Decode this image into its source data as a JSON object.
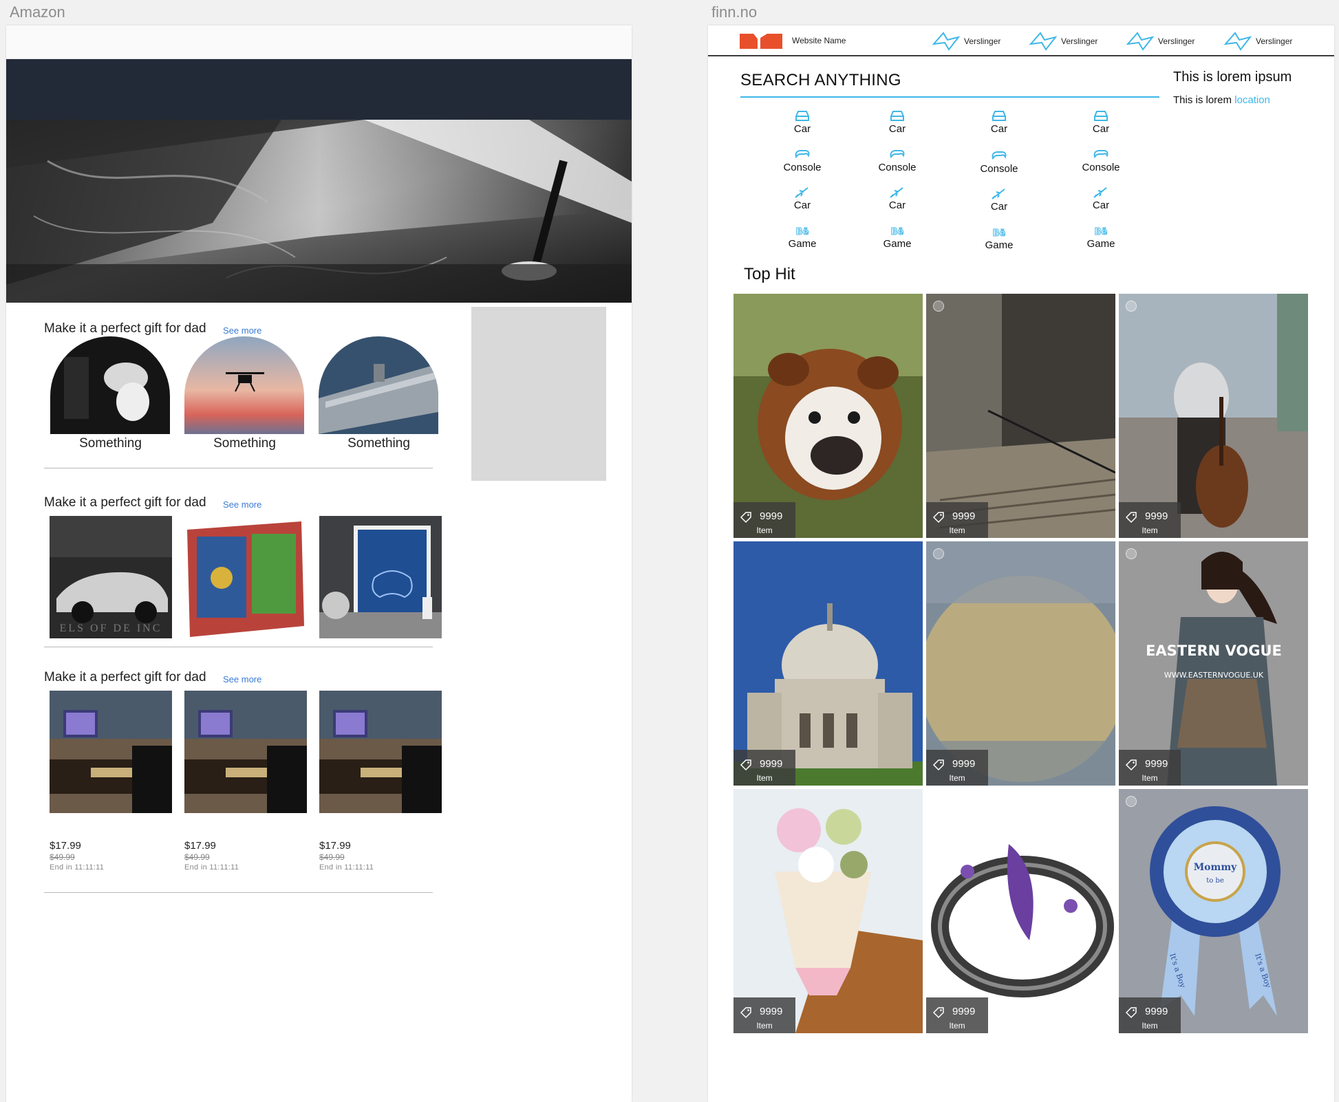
{
  "artboards": {
    "amazon_label": "Amazon",
    "finn_label": "finn.no"
  },
  "amazon": {
    "sections": [
      {
        "title": "Make it a perfect gift for dad",
        "see_more": "See more"
      },
      {
        "title": "Make it a perfect gift for dad",
        "see_more": "See more"
      },
      {
        "title": "Make it a perfect gift for dad",
        "see_more": "See more"
      }
    ],
    "circle_items": [
      {
        "label": "Something"
      },
      {
        "label": "Something"
      },
      {
        "label": "Something"
      }
    ],
    "product_image_text": "ELS OF DE INC",
    "deals": [
      {
        "price": "$17.99",
        "old_price": "$49.99",
        "ends": "End in 11:11:11"
      },
      {
        "price": "$17.99",
        "old_price": "$49.99",
        "ends": "End in 11:11:11"
      },
      {
        "price": "$17.99",
        "old_price": "$49.99",
        "ends": "End in 11:11:11"
      }
    ]
  },
  "finn": {
    "site_name": "Website Name",
    "nav": [
      {
        "label": "Verslinger"
      },
      {
        "label": "Verslinger"
      },
      {
        "label": "Verslinger"
      },
      {
        "label": "Verslinger"
      }
    ],
    "search_label": "SEARCH ANYTHING",
    "aside": {
      "title": "This is lorem ipsum",
      "text": "This is lorem ",
      "link": "location"
    },
    "categories": [
      [
        "Car",
        "Car",
        "Car",
        "Car"
      ],
      [
        "Console",
        "Console",
        "Console",
        "Console"
      ],
      [
        "Car",
        "Car",
        "Car",
        "Car"
      ],
      [
        "Game",
        "Game",
        "Game",
        "Game"
      ]
    ],
    "category_icons": [
      "car-icon",
      "gamepad-icon",
      "plane-icon",
      "behance-icon"
    ],
    "top_hit": "Top Hit",
    "tiles": [
      {
        "value": "9999",
        "label": "Item",
        "subject": "bulldog"
      },
      {
        "value": "9999",
        "label": "Item",
        "subject": "stairs"
      },
      {
        "value": "9999",
        "label": "Item",
        "subject": "bass-player"
      },
      {
        "value": "9999",
        "label": "Item",
        "subject": "palace"
      },
      {
        "value": "9999",
        "label": "Item",
        "subject": "moon"
      },
      {
        "value": "9999",
        "label": "Item",
        "subject": "fashion-model",
        "image_text": [
          "EASTERN VOGUE",
          "WWW.EASTERNVOGUE.UK"
        ]
      },
      {
        "value": "9999",
        "label": "Item",
        "subject": "ice-cream"
      },
      {
        "value": "9999",
        "label": "Item",
        "subject": "ring"
      },
      {
        "value": "9999",
        "label": "Item",
        "subject": "rosette",
        "image_text": [
          "Mommy",
          "to be",
          "It's a Boy",
          "It's a Boy"
        ]
      }
    ],
    "accent_color": "#3fb7e8",
    "logo_color": "#e8502c"
  }
}
